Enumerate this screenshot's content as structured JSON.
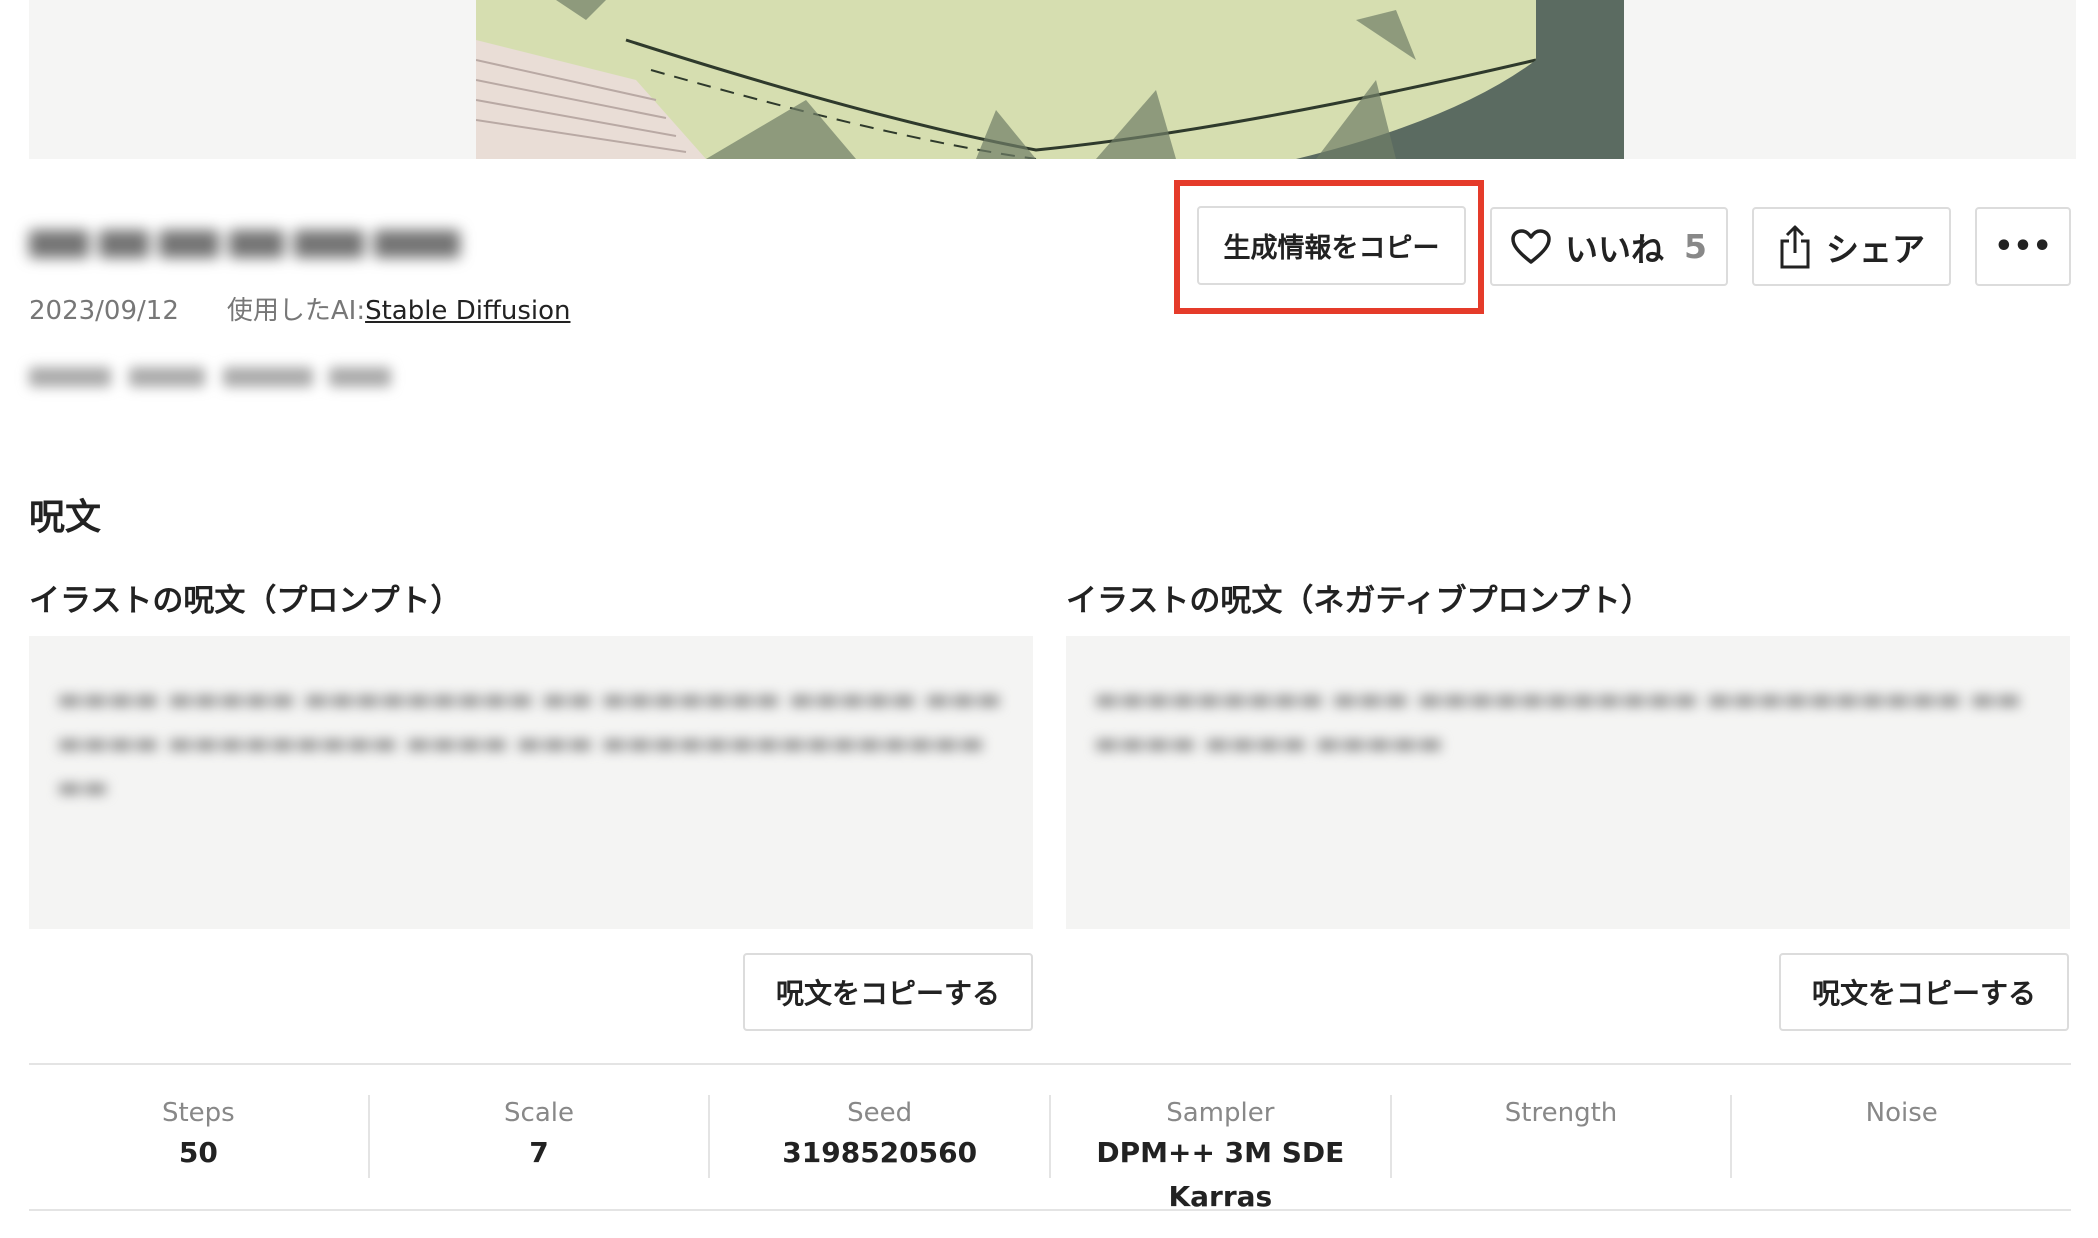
{
  "post": {
    "date": "2023/09/12",
    "ai_label": "使用したAI:",
    "ai_name": "Stable Diffusion"
  },
  "actions": {
    "copy_info_label": "生成情報をコピー",
    "like_label": "いいね",
    "like_count": "5",
    "share_label": "シェア",
    "more_label": "•••",
    "highlight_color": "#e53b2a"
  },
  "prompt_section": {
    "title": "呪文",
    "prompt_heading": "イラストの呪文（プロンプト）",
    "negative_heading": "イラストの呪文（ネガティブプロンプト）",
    "copy_prompt_label": "呪文をコピーする",
    "copy_negative_label": "呪文をコピーする"
  },
  "params": [
    {
      "label": "Steps",
      "value": "50"
    },
    {
      "label": "Scale",
      "value": "7"
    },
    {
      "label": "Seed",
      "value": "3198520560"
    },
    {
      "label": "Sampler",
      "value": "DPM++ 3M SDE Karras"
    },
    {
      "label": "Strength",
      "value": ""
    },
    {
      "label": "Noise",
      "value": ""
    }
  ]
}
